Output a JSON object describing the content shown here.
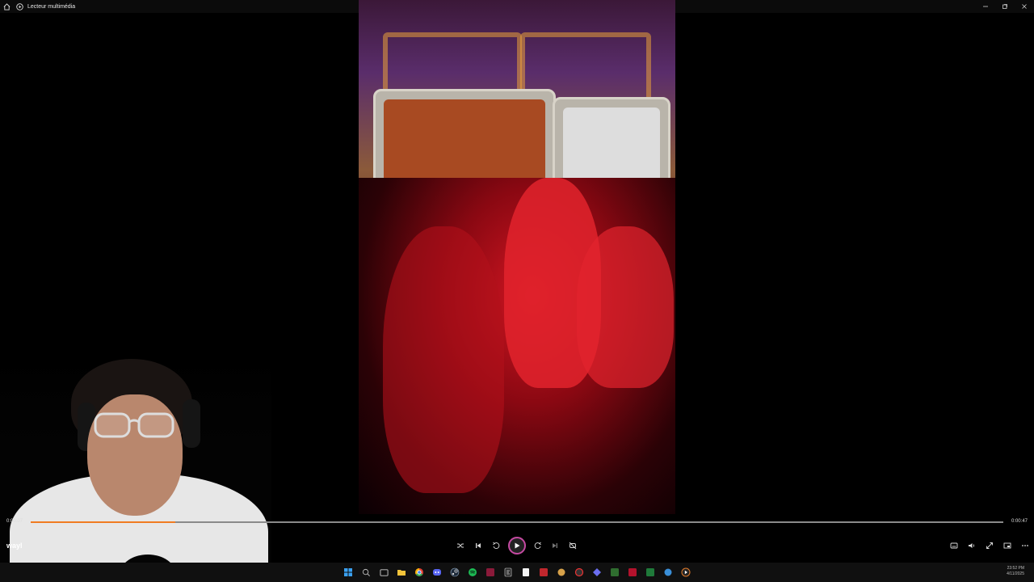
{
  "window": {
    "title": "Lecteur multimédia",
    "icons": [
      "home-icon",
      "media-player-icon"
    ],
    "controls": [
      "minimize-icon",
      "restore-icon",
      "close-icon"
    ]
  },
  "player": {
    "current_time": "0:00:07",
    "total_time": "0:00:47",
    "progress_fraction": 0.149,
    "caption_text": "wayl",
    "controls_left": [
      "shuffle-icon",
      "previous-icon",
      "rewind-10-icon",
      "play-icon",
      "forward-30-icon",
      "next-icon",
      "repeat-off-icon"
    ],
    "controls_right": [
      "subtitles-icon",
      "volume-icon",
      "fullscreen-icon",
      "mini-player-icon",
      "more-options-icon"
    ],
    "accent_color": "#f07c22",
    "play_ring_color": "#c54aa2"
  },
  "taskbar": {
    "apps": [
      "windows-start-icon",
      "search-icon",
      "task-view-icon",
      "file-explorer-icon",
      "chrome-icon",
      "discord-icon",
      "steam-icon",
      "spotify-icon",
      "app-icon",
      "epic-games-icon",
      "notepad-icon",
      "app-icon",
      "app-icon",
      "app-icon",
      "app-icon",
      "app-icon",
      "app-icon",
      "app-icon",
      "app-icon",
      "media-player-icon"
    ],
    "clock_time": "23:52 PM",
    "clock_date": "4/11/2025"
  }
}
